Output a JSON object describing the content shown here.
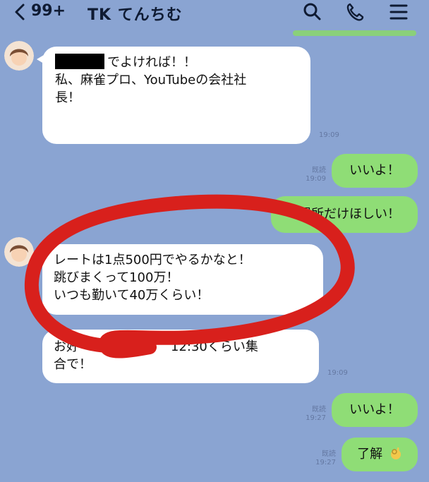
{
  "header": {
    "unread_count": "99+",
    "title": "TK てんちむ"
  },
  "colors": {
    "background": "#8aa4d2",
    "incoming_bubble": "#ffffff",
    "outgoing_bubble": "#8fdd76",
    "annotation": "#d8201c"
  },
  "icons": [
    "chevron-left-icon",
    "search-icon",
    "phone-icon",
    "menu-icon"
  ],
  "messages": {
    "m1": {
      "line1": "でよければ！！",
      "line2": "私、麻雀プロ、YouTubeの会社社",
      "line3": "長！",
      "time": "19:09"
    },
    "m2": {
      "text": "いいよ！",
      "read": "既読",
      "time": "19:09"
    },
    "m3": {
      "text": "場所だけほしい！"
    },
    "m4": {
      "line1": "レートは1点500円でやるかなと！",
      "line2": "跳びまくって100万！",
      "line3": "いつも勤いて40万くらい！"
    },
    "m5": {
      "line1_start": "お好",
      "line1_end": "12:30くらい集",
      "line2": "合で！",
      "time": "19:09"
    },
    "m6": {
      "text": "いいよ！",
      "read": "既読",
      "time": "19:27"
    },
    "m7": {
      "text": "了解",
      "read": "既読",
      "time": "19:27"
    }
  }
}
